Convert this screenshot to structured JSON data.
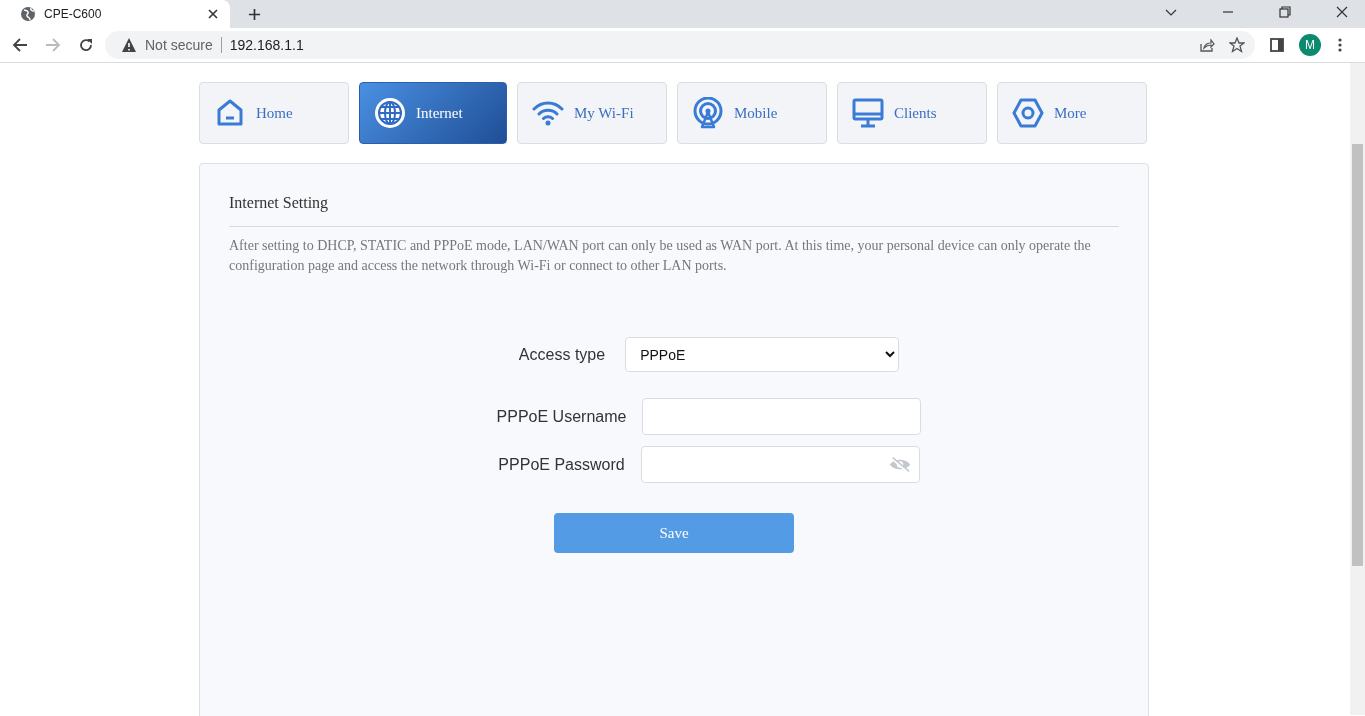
{
  "browser": {
    "tab_title": "CPE-C600",
    "security_label": "Not secure",
    "url": "192.168.1.1",
    "profile_initial": "M"
  },
  "nav_tabs": [
    {
      "label": "Home",
      "kind": "home",
      "selected": false
    },
    {
      "label": "Internet",
      "kind": "globe",
      "selected": true
    },
    {
      "label": "My Wi-Fi",
      "kind": "wifi",
      "selected": false
    },
    {
      "label": "Mobile",
      "kind": "antenna",
      "selected": false
    },
    {
      "label": "Clients",
      "kind": "monitor",
      "selected": false
    },
    {
      "label": "More",
      "kind": "hexagon",
      "selected": false
    }
  ],
  "panel": {
    "title": "Internet Setting",
    "description": "After setting to DHCP, STATIC and PPPoE mode, LAN/WAN port can only be used as WAN port. At this time, your personal device can only operate the configuration page and access the network through Wi-Fi or connect to other LAN ports.",
    "fields": [
      {
        "kind": "select",
        "label": "Access type",
        "value": "PPPoE"
      },
      {
        "kind": "text",
        "label": "PPPoE Username"
      },
      {
        "kind": "password",
        "label": "PPPoE Password"
      }
    ],
    "save_button": "Save"
  }
}
